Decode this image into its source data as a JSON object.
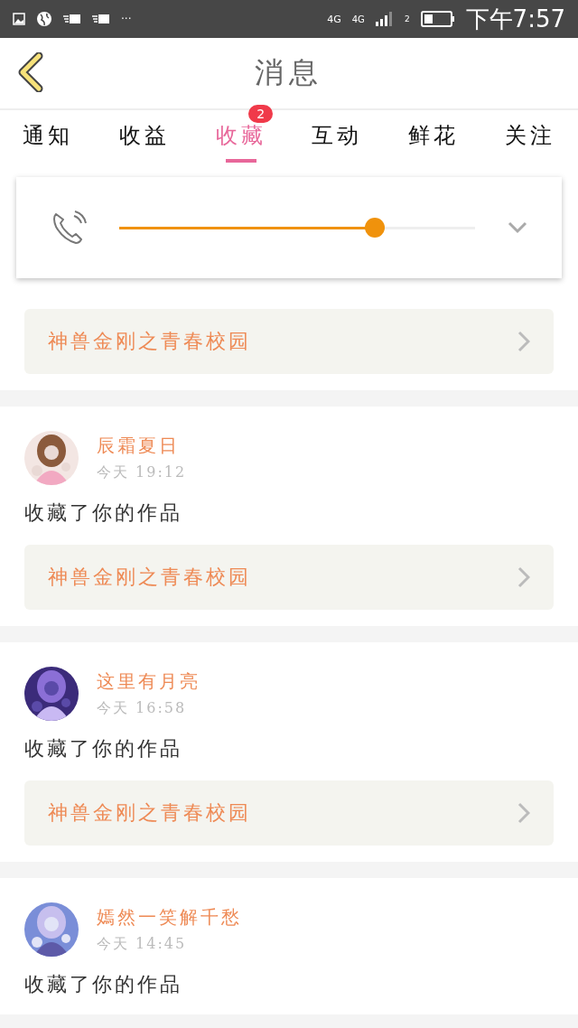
{
  "status_bar": {
    "time": "下午7:57",
    "more": "···",
    "network_1": "4G",
    "network_2": "4G",
    "sim": "2"
  },
  "header": {
    "title": "消息"
  },
  "tabs": [
    {
      "label": "通知",
      "selected": false
    },
    {
      "label": "收益",
      "selected": false
    },
    {
      "label": "收藏",
      "selected": true,
      "badge": "2"
    },
    {
      "label": "互动",
      "selected": false
    },
    {
      "label": "鲜花",
      "selected": false
    },
    {
      "label": "关注",
      "selected": false
    }
  ],
  "volume_panel": {
    "level": 0.73
  },
  "messages": [
    {
      "kind": "partial",
      "work": "神兽金刚之青春校园"
    },
    {
      "kind": "full",
      "user": "辰霜夏日",
      "day": "今天",
      "time": "19:12",
      "text": "收藏了你的作品",
      "work": "神兽金刚之青春校园"
    },
    {
      "kind": "full",
      "user": "这里有月亮",
      "day": "今天",
      "time": "16:58",
      "text": "收藏了你的作品",
      "work": "神兽金刚之青春校园"
    },
    {
      "kind": "full",
      "user": "嫣然一笑解千愁",
      "day": "今天",
      "time": "14:45",
      "text": "收藏了你的作品"
    }
  ]
}
